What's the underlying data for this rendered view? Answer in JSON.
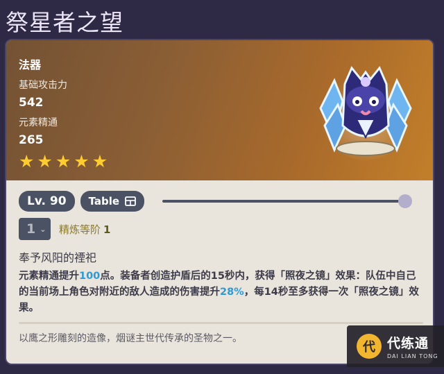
{
  "page": {
    "title": "祭星者之望"
  },
  "weapon": {
    "type": "法器",
    "base_atk_label": "基础攻击力",
    "base_atk_value": "542",
    "substat_label": "元素精通",
    "substat_value": "265",
    "rarity_stars": 5,
    "star_glyph": "★",
    "art_icon": "weapon-art-icon"
  },
  "controls": {
    "level_label": "Lv. 90",
    "table_label": "Table",
    "level_slider_fraction": 1.0,
    "refine_value": "1",
    "refine_label": "精炼等阶",
    "refine_level": "1"
  },
  "passive": {
    "name": "奉予风阳的禋祀",
    "desc_1": "元素精通提升",
    "hl_1": "100",
    "desc_2": "点。装备者创造护盾后的15秒内，获得「照夜之镜」效果：队伍中自己的当前场上角色对附近的敌人造成的伤害提升",
    "hl_2": "28%",
    "desc_3": "，每14秒至多获得一次「照夜之镜」效果。"
  },
  "lore": "以鹰之形雕刻的造像，烟谜主世代传承的圣物之一。",
  "watermark": {
    "cn": "代练通",
    "en": "DAI LIAN TONG"
  },
  "colors": {
    "background": "#2e2a45",
    "card_top_start": "#735234",
    "card_top_end": "#c27f2a",
    "highlight": "#2d9ad8",
    "star": "#ffcc32",
    "control": "#4b5263"
  }
}
